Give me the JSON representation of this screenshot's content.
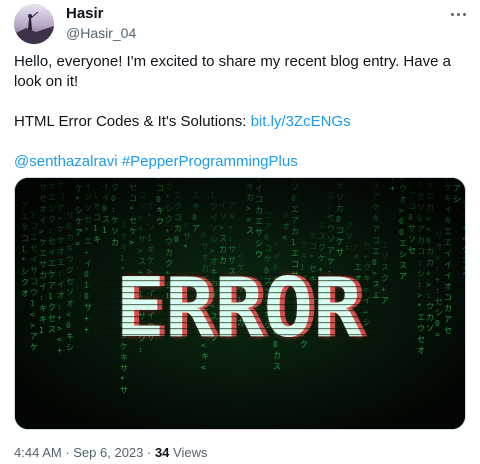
{
  "author": {
    "name": "Hasir",
    "handle": "@Hasir_04"
  },
  "tweet": {
    "line1": "Hello, everyone! I'm excited to share my recent blog entry. Have a look on it!",
    "line2_prefix": "HTML Error Codes & It's Solutions: ",
    "line2_link": "bit.ly/3ZcENGs",
    "mention": "@senthazalravi",
    "hashtag": "#PepperProgrammingPlus"
  },
  "media": {
    "text": "ERROR"
  },
  "meta": {
    "time": "4:44 AM",
    "separator1": " · ",
    "date": "Sep 6, 2023",
    "separator2": " · ",
    "views_count": "34",
    "views_label": " Views"
  },
  "colors": {
    "link": "#1d9bf0",
    "muted": "#536471",
    "matrix_green": "#2fd35c"
  },
  "icons": {
    "more": "more-horizontal-icon"
  }
}
